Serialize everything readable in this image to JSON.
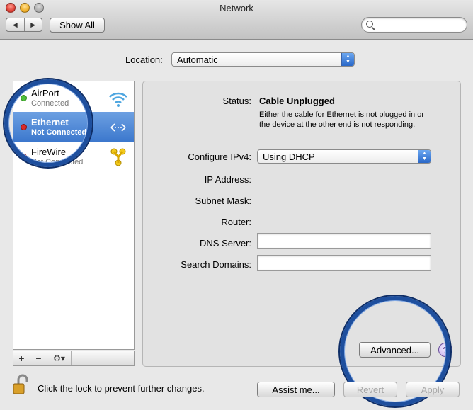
{
  "window": {
    "title": "Network"
  },
  "toolbar": {
    "back": "◀",
    "forward": "▶",
    "show_all": "Show All",
    "search_placeholder": ""
  },
  "location": {
    "label": "Location:",
    "value": "Automatic"
  },
  "services": [
    {
      "name": "AirPort",
      "status": "Connected",
      "dot_color": "#4fbf3a",
      "icon": "wifi-icon"
    },
    {
      "name": "Ethernet",
      "status": "Not Connected",
      "dot_color": "#d92a2a",
      "icon": "ethernet-icon"
    },
    {
      "name": "FireWire",
      "status": "Not Connected",
      "dot_color": "#d92a2a",
      "icon": "firewire-icon"
    }
  ],
  "sidebar_controls": {
    "add": "+",
    "remove": "−",
    "gear": "⚙▾"
  },
  "detail": {
    "status_label": "Status:",
    "status_value": "Cable Unplugged",
    "status_description": "Either the cable for Ethernet is not plugged in or the device at the other end is not responding.",
    "configure_label": "Configure IPv4:",
    "configure_value": "Using DHCP",
    "ip_label": "IP Address:",
    "subnet_label": "Subnet Mask:",
    "router_label": "Router:",
    "dns_label": "DNS Server:",
    "dns_value": "",
    "search_domains_label": "Search Domains:",
    "search_domains_value": "",
    "advanced": "Advanced...",
    "help": "?"
  },
  "footer": {
    "lock_text": "Click the lock to prevent further changes.",
    "assist": "Assist me...",
    "revert": "Revert",
    "apply": "Apply"
  },
  "colors": {
    "selection": "#3c78cd",
    "magnifier_ring": "#1e4f9e"
  }
}
